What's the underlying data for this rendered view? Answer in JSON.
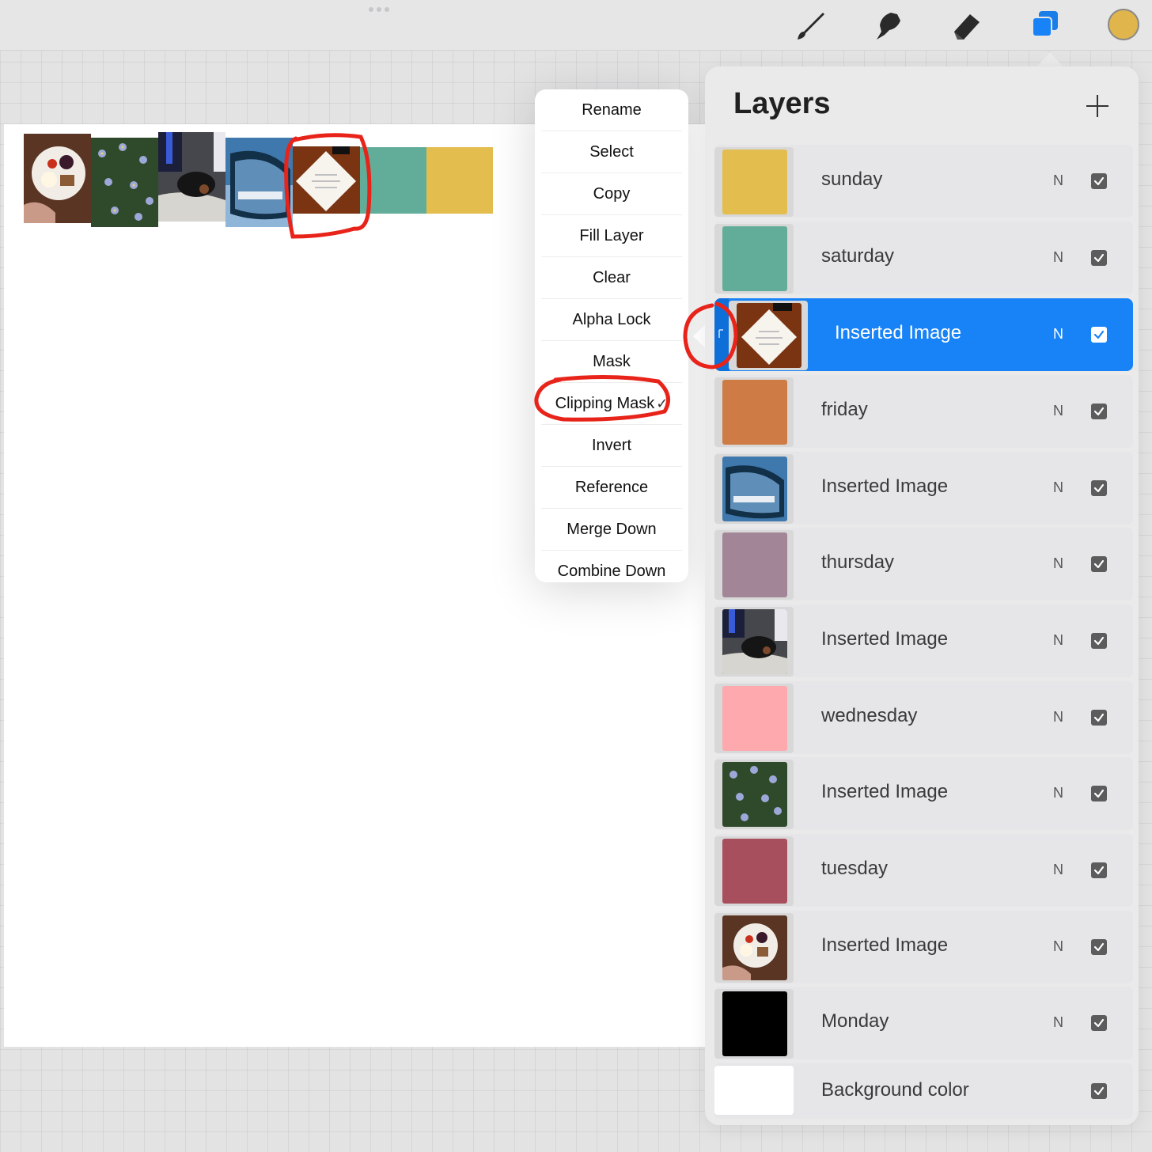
{
  "toolbar": {
    "tools": [
      {
        "name": "brush",
        "icon": "brush-icon"
      },
      {
        "name": "smudge",
        "icon": "smudge-icon"
      },
      {
        "name": "eraser",
        "icon": "eraser-icon"
      },
      {
        "name": "layers",
        "icon": "layers-icon",
        "active": true
      }
    ],
    "current_color": "#e0b64c"
  },
  "context_menu": {
    "items": [
      {
        "label": "Rename"
      },
      {
        "label": "Select"
      },
      {
        "label": "Copy"
      },
      {
        "label": "Fill Layer"
      },
      {
        "label": "Clear"
      },
      {
        "label": "Alpha Lock"
      },
      {
        "label": "Mask"
      },
      {
        "label": "Clipping Mask",
        "checked": true
      },
      {
        "label": "Invert"
      },
      {
        "label": "Reference"
      },
      {
        "label": "Merge Down"
      },
      {
        "label": "Combine Down"
      }
    ],
    "check_glyph": "✓"
  },
  "layers_panel": {
    "title": "Layers",
    "add_icon": "plus-icon",
    "layers": [
      {
        "name": "sunday",
        "blend": "N",
        "visible": true,
        "thumb_color": "#e3bd4e"
      },
      {
        "name": "saturday",
        "blend": "N",
        "visible": true,
        "thumb_color": "#62ad99"
      },
      {
        "name": "Inserted Image",
        "blend": "N",
        "visible": true,
        "selected": true,
        "clipped": true,
        "thumb_icon": "note-photo-icon"
      },
      {
        "name": "friday",
        "blend": "N",
        "visible": true,
        "thumb_color": "#cf7b45"
      },
      {
        "name": "Inserted Image",
        "blend": "N",
        "visible": true,
        "thumb_icon": "car-mirror-photo-icon"
      },
      {
        "name": "thursday",
        "blend": "N",
        "visible": true,
        "thumb_color": "#a28596"
      },
      {
        "name": "Inserted Image",
        "blend": "N",
        "visible": true,
        "thumb_icon": "dog-photo-icon"
      },
      {
        "name": "wednesday",
        "blend": "N",
        "visible": true,
        "thumb_color": "#fda9ad"
      },
      {
        "name": "Inserted Image",
        "blend": "N",
        "visible": true,
        "thumb_icon": "flowers-photo-icon"
      },
      {
        "name": "tuesday",
        "blend": "N",
        "visible": true,
        "thumb_color": "#a84f5d"
      },
      {
        "name": "Inserted Image",
        "blend": "N",
        "visible": true,
        "thumb_icon": "food-plate-photo-icon"
      },
      {
        "name": "Monday",
        "blend": "N",
        "visible": true,
        "thumb_color": "#000000"
      },
      {
        "name": "Background color",
        "blend": "",
        "visible": true,
        "thumb_color": "#ffffff"
      }
    ]
  },
  "canvas": {
    "tiles": [
      {
        "icon": "food-plate-photo-icon"
      },
      {
        "icon": "flowers-photo-icon"
      },
      {
        "icon": "dog-photo-icon"
      },
      {
        "icon": "car-mirror-photo-icon"
      },
      {
        "icon": "note-photo-icon"
      },
      {
        "color": "#62ad99"
      },
      {
        "color": "#e3bd4e"
      }
    ]
  },
  "annotation_color": "#e8231a"
}
